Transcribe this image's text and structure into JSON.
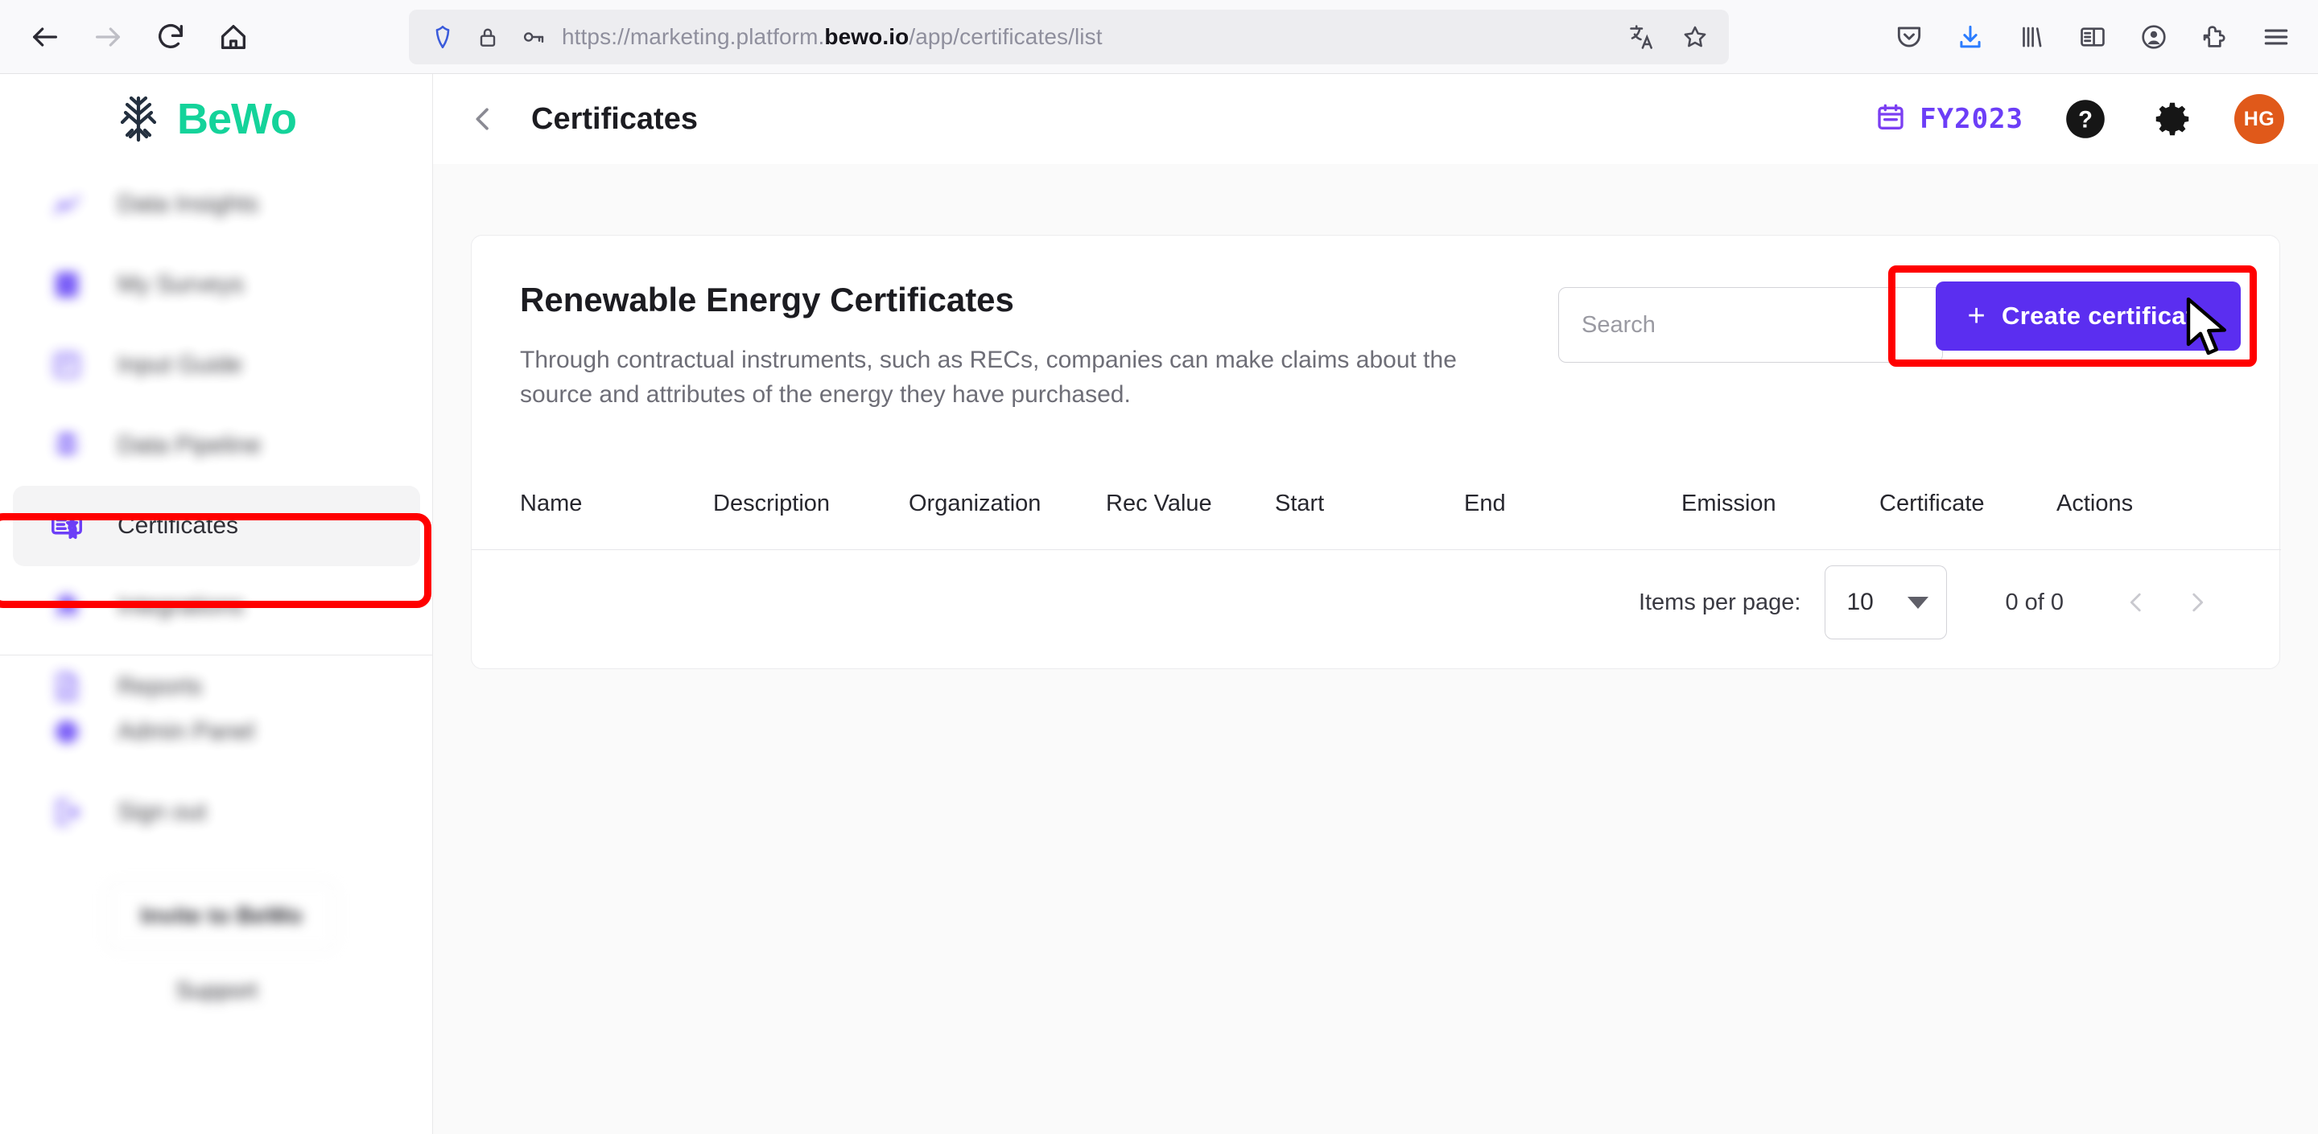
{
  "browser": {
    "nav": {
      "back_label": "Back",
      "forward_label": "Forward",
      "reload_label": "Reload",
      "home_label": "Home"
    },
    "url": {
      "prefix": "https://marketing.platform.",
      "domain": "bewo.io",
      "suffix": "/app/certificates/list"
    },
    "urlbar_icons": [
      "shield-icon",
      "lock-icon",
      "key-icon"
    ],
    "urlbar_right_icons": [
      "translate-icon",
      "bookmark-star-icon"
    ],
    "toolbar_icons": [
      "pocket-icon",
      "download-icon",
      "library-icon",
      "sidebar-icon",
      "account-icon",
      "extensions-icon",
      "menu-icon"
    ]
  },
  "sidebar": {
    "brand": "BeWo",
    "items": [
      {
        "label": "Data Insights",
        "icon": "insights-icon",
        "blurred": true,
        "active": false
      },
      {
        "label": "My Surveys",
        "icon": "surveys-icon",
        "blurred": true,
        "active": false
      },
      {
        "label": "Input Guide",
        "icon": "guide-icon",
        "blurred": true,
        "active": false
      },
      {
        "label": "Data Pipeline",
        "icon": "pipeline-icon",
        "blurred": true,
        "active": false
      },
      {
        "label": "Certificates",
        "icon": "certificate-icon",
        "blurred": false,
        "active": true
      },
      {
        "label": "Integrations",
        "icon": "integrations-icon",
        "blurred": true,
        "active": false
      },
      {
        "label": "Reports",
        "icon": "reports-icon",
        "blurred": true,
        "active": false
      }
    ],
    "bottom_items": [
      {
        "label": "Admin Panel",
        "icon": "admin-icon",
        "blurred": true
      },
      {
        "label": "Sign out",
        "icon": "signout-icon",
        "blurred": true
      }
    ],
    "invite_button": "Invite to BeWo",
    "support_link": "Support"
  },
  "header": {
    "title": "Certificates",
    "back_icon": "chevron-left-icon",
    "fiscal_year": "FY2023",
    "calendar_icon": "calendar-icon",
    "help_icon": "help-circle-icon",
    "settings_icon": "gear-icon",
    "avatar_initials": "HG"
  },
  "main": {
    "card_title": "Renewable Energy Certificates",
    "card_description": "Through contractual instruments, such as RECs, companies can make claims about the source and attributes of the energy they have purchased.",
    "search": {
      "value": "",
      "placeholder": "Search"
    },
    "create_button": {
      "label": "Create certificate",
      "plus": "+"
    },
    "table": {
      "columns": [
        "Name",
        "Description",
        "Organization",
        "Rec Value",
        "Start",
        "End",
        "Emission",
        "Certificate",
        "Actions"
      ],
      "rows": []
    },
    "paginator": {
      "items_per_page_label": "Items per page:",
      "items_per_page_value": "10",
      "range_label": "0 of 0",
      "prev_icon": "chevron-left-icon",
      "next_icon": "chevron-right-icon"
    }
  },
  "colors": {
    "brand_green": "#14d39a",
    "accent_purple": "#5b2ef0",
    "fy_purple": "#6c3ef7",
    "avatar_orange": "#e0591a",
    "highlight_red": "#ff0000",
    "page_bg": "#fafafa"
  },
  "annotations": {
    "highlight_sidebar_target": "Certificates",
    "highlight_button_target": "Create certificate",
    "cursor_icon": "mouse-pointer-icon"
  }
}
